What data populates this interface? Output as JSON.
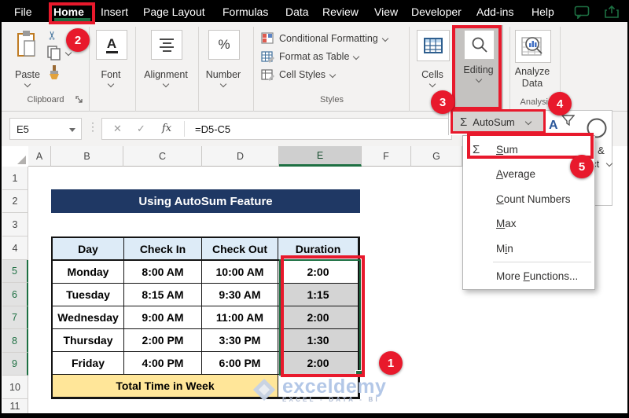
{
  "menu": {
    "tabs": [
      "File",
      "Home",
      "Insert",
      "Page Layout",
      "Formulas",
      "Data",
      "Review",
      "View",
      "Developer",
      "Add-ins",
      "Help"
    ]
  },
  "ribbon": {
    "paste": "Paste",
    "clipboard_group": "Clipboard",
    "font_group": "Font",
    "alignment_group": "Alignment",
    "number_group": "Number",
    "styles": {
      "items": [
        "Conditional Formatting",
        "Format as Table",
        "Cell Styles"
      ],
      "group": "Styles"
    },
    "cells": "Cells",
    "editing": "Editing",
    "analyze_line1": "Analyze",
    "analyze_line2": "Data",
    "analysis_group": "Analysis"
  },
  "glyphs": {
    "sigma": "Σ",
    "percent": "%",
    "letter_a": "A",
    "cut": "✂",
    "dots": "⋮",
    "cancel": "✕",
    "confirm": "✓",
    "fx": "fx"
  },
  "formula_bar": {
    "cell_ref": "E5",
    "formula": "=D5-C5"
  },
  "sheet": {
    "cols": [
      "A",
      "B",
      "C",
      "D",
      "E",
      "F",
      "G"
    ],
    "rows": [
      "1",
      "2",
      "3",
      "4",
      "5",
      "6",
      "7",
      "8",
      "9",
      "10",
      "11"
    ],
    "banner": "Using AutoSum Feature",
    "table": {
      "headers": [
        "Day",
        "Check In",
        "Check Out",
        "Duration"
      ],
      "rows": [
        [
          "Monday",
          "8:00 AM",
          "10:00 AM",
          "2:00"
        ],
        [
          "Tuesday",
          "8:15 AM",
          "9:30 AM",
          "1:15"
        ],
        [
          "Wednesday",
          "9:00 AM",
          "11:00 AM",
          "2:00"
        ],
        [
          "Thursday",
          "2:00 PM",
          "3:30 PM",
          "1:30"
        ],
        [
          "Friday",
          "4:00 PM",
          "6:00 PM",
          "2:00"
        ]
      ],
      "footer": "Total Time in Week"
    }
  },
  "flyout": {
    "autosum": "AutoSum",
    "find_select_frag_top": "nd &",
    "find_select_frag_bottom": "lect"
  },
  "autosum_menu": {
    "items": [
      {
        "pre": "",
        "u": "S",
        "post": "um"
      },
      {
        "pre": "",
        "u": "A",
        "post": "verage"
      },
      {
        "pre": "",
        "u": "C",
        "post": "ount Numbers"
      },
      {
        "pre": "",
        "u": "M",
        "post": "ax"
      },
      {
        "pre": "M",
        "u": "i",
        "post": "n"
      },
      {
        "pre": "More ",
        "u": "F",
        "post": "unctions..."
      }
    ]
  },
  "badges": [
    "1",
    "2",
    "3",
    "4",
    "5"
  ],
  "watermark": {
    "name": "exceldemy",
    "tagline": "EXCEL - DATA - BI"
  },
  "colors": {
    "excel_green": "#1d6f42",
    "annotation_red": "#e8192c",
    "banner_navy": "#1f3864",
    "table_header_blue": "#ddebf7",
    "total_row_yellow": "#ffe699",
    "selection_gray": "#d4d4d4"
  }
}
